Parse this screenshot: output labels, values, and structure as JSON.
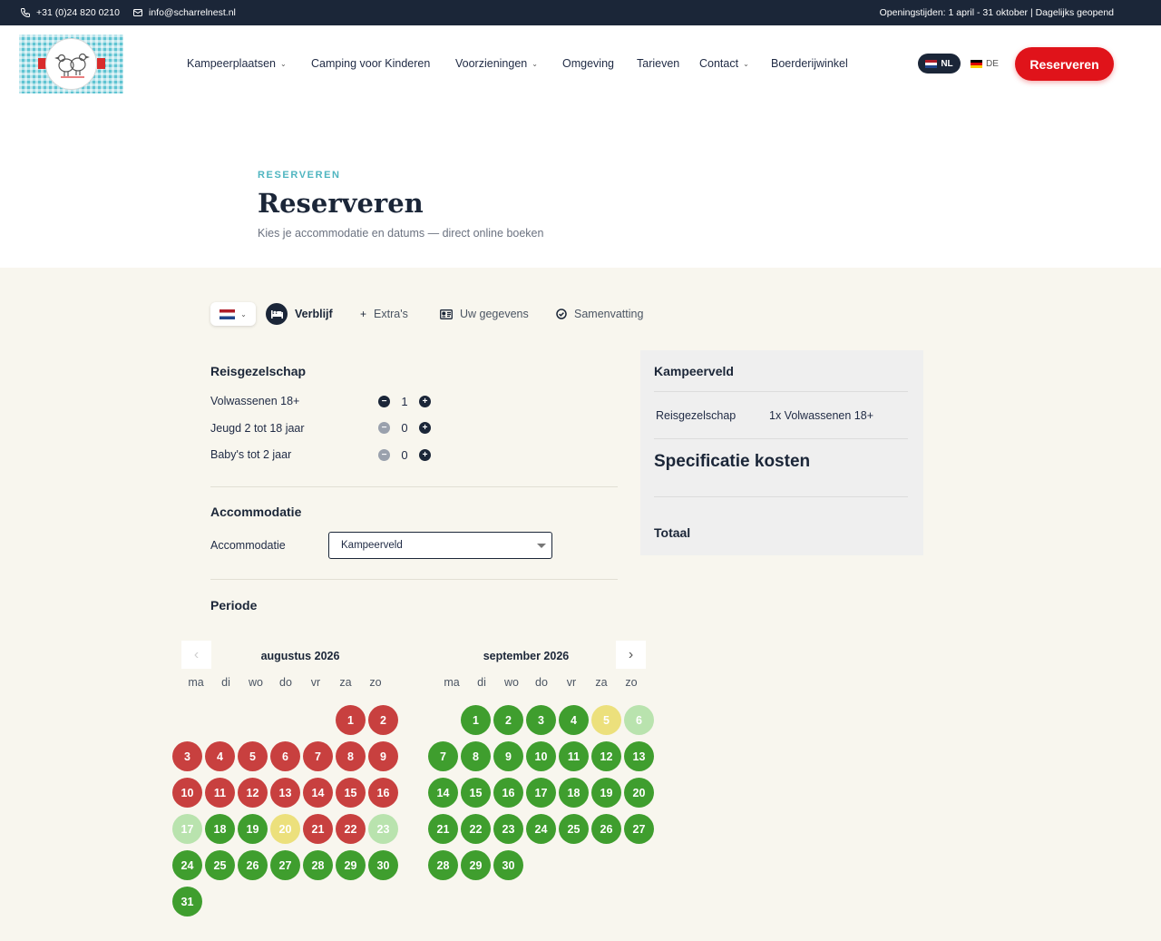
{
  "topbar": {
    "phone": "+31 (0)24 820 0210",
    "email": "info@scharrelnest.nl",
    "hours": "Openingstijden: 1 april - 31 oktober | Dagelijks geopend"
  },
  "nav": {
    "items": [
      {
        "label": "Kampeerplaatsen",
        "dropdown": true
      },
      {
        "label": "Camping voor Kinderen",
        "dropdown": false
      },
      {
        "label": "Voorzieningen",
        "dropdown": true
      },
      {
        "label": "Omgeving",
        "dropdown": false
      },
      {
        "label": "Tarieven",
        "dropdown": false
      },
      {
        "label": "Contact",
        "dropdown": true
      },
      {
        "label": "Boerderijwinkel",
        "dropdown": false
      }
    ],
    "lang_active": "NL",
    "lang_other": "DE",
    "reserve_label": "Reserveren"
  },
  "hero": {
    "eyebrow": "RESERVEREN",
    "title": "Reserveren",
    "subtitle": "Kies je accommodatie en datums — direct online boeken"
  },
  "steps": [
    {
      "label": "Verblijf",
      "icon": "bed-icon",
      "active": true
    },
    {
      "label": "Extra's",
      "icon": "plus-icon",
      "active": false
    },
    {
      "label": "Uw gegevens",
      "icon": "id-card-icon",
      "active": false
    },
    {
      "label": "Samenvatting",
      "icon": "check-circle-icon",
      "active": false
    }
  ],
  "party": {
    "title": "Reisgezelschap",
    "rows": [
      {
        "label": "Volwassenen 18+",
        "value": "1"
      },
      {
        "label": "Jeugd 2 tot 18 jaar",
        "value": "0"
      },
      {
        "label": "Baby's tot 2 jaar",
        "value": "0"
      }
    ]
  },
  "accommodation": {
    "title": "Accommodatie",
    "label": "Accommodatie",
    "selected": "Kampeerveld"
  },
  "period": {
    "title": "Periode",
    "weekdays": [
      "ma",
      "di",
      "wo",
      "do",
      "vr",
      "za",
      "zo"
    ],
    "months": [
      {
        "title": "augustus 2026",
        "offset": 5,
        "days": 31,
        "status": {
          "1": "red",
          "2": "red",
          "3": "red",
          "4": "red",
          "5": "red",
          "6": "red",
          "7": "red",
          "8": "red",
          "9": "red",
          "10": "red",
          "11": "red",
          "12": "red",
          "13": "red",
          "14": "red",
          "15": "red",
          "16": "red",
          "17": "light",
          "18": "green",
          "19": "green",
          "20": "yellow",
          "21": "red",
          "22": "red",
          "23": "light"
        },
        "default": "green"
      },
      {
        "title": "september 2026",
        "offset": 1,
        "days": 30,
        "status": {
          "5": "yellow",
          "6": "light"
        },
        "default": "green"
      }
    ]
  },
  "summary": {
    "title": "Kampeerveld",
    "party_label": "Reisgezelschap",
    "party_value": "1x Volwassenen 18+",
    "spec_title": "Specificatie kosten",
    "total_label": "Totaal"
  },
  "colors": {
    "navy": "#1b2638",
    "accent_red": "#e0131a",
    "available": "#3f9e2e",
    "unavailable": "#c8403f",
    "partial": "#ece07c",
    "limited": "#b9e3ae",
    "teal": "#4fb5c0"
  }
}
